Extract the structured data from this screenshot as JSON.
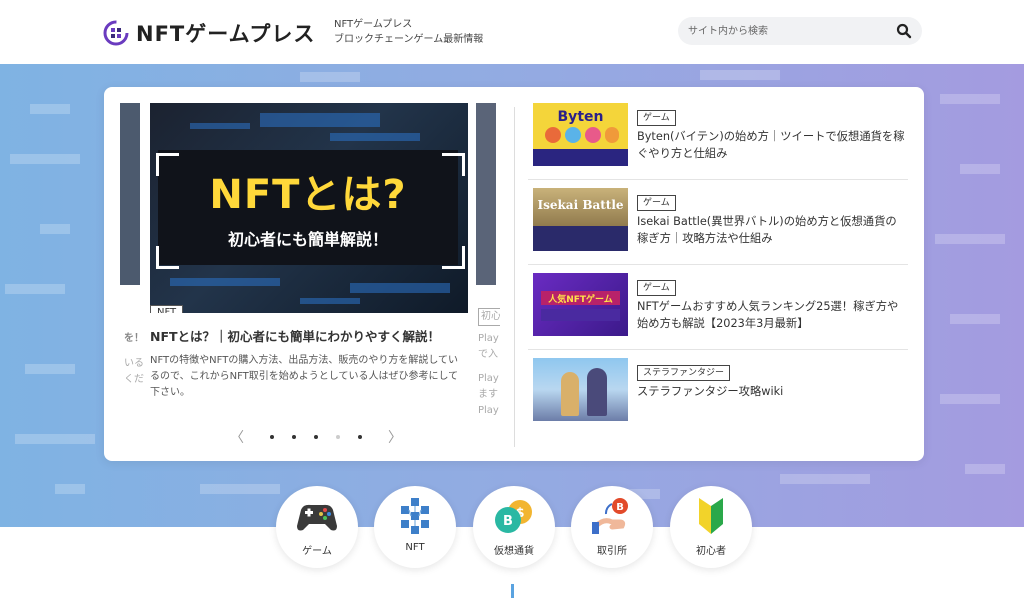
{
  "header": {
    "logo_text": "NFTゲームプレス",
    "tagline_1": "NFTゲームプレス",
    "tagline_2": "ブロックチェーンゲーム最新情報",
    "search_placeholder": "サイト内から検索"
  },
  "slider": {
    "prev_partial_title": "を！",
    "prev_partial_desc": [
      "いる",
      "くだ"
    ],
    "next_partial_tag": "初心",
    "next_partial_title": [
      "Play",
      "で入"
    ],
    "next_partial_desc": [
      "Play",
      "ます",
      "Play"
    ],
    "active_slide": {
      "image_title": "NFTとは?",
      "image_subtitle": "初心者にも簡単解説！",
      "tag": "NFT",
      "title": "NFTとは？｜初心者にも簡単にわかりやすく解説！",
      "desc": "NFTの特徴やNFTの購入方法、出品方法、販売のやり方を解説しているので、これからNFT取引を始めようとしている人はぜひ参考にして下さい。"
    },
    "prev_label": "〈",
    "next_label": "〉",
    "dots": [
      true,
      true,
      true,
      false,
      true
    ]
  },
  "posts": [
    {
      "tag": "ゲーム",
      "title": "Byten(バイテン)の始め方｜ツイートで仮想通貨を稼ぐやり方と仕組み",
      "thumb_title": "Byten"
    },
    {
      "tag": "ゲーム",
      "title": "Isekai Battle(異世界バトル)の始め方と仮想通貨の稼ぎ方｜攻略方法や仕組み",
      "thumb_title": "Isekai Battle"
    },
    {
      "tag": "ゲーム",
      "title": "NFTゲームおすすめ人気ランキング25選！稼ぎ方や始め方も解説【2023年3月最新】",
      "thumb_title": "人気NFTゲーム"
    },
    {
      "tag": "ステラファンタジー",
      "title": "ステラファンタジー攻略wiki",
      "thumb_title": ""
    }
  ],
  "categories": [
    {
      "label": "ゲーム",
      "icon": "gamepad-icon"
    },
    {
      "label": "NFT",
      "icon": "blocks-icon"
    },
    {
      "label": "仮想通貨",
      "icon": "coins-icon"
    },
    {
      "label": "取引所",
      "icon": "exchange-icon"
    },
    {
      "label": "初心者",
      "icon": "beginner-mark-icon"
    }
  ],
  "colors": {
    "hero_left": "#7fb3e3",
    "hero_right": "#a49be0",
    "accent_yellow": "#ffd83a",
    "logo_purple": "#6a3bbf"
  }
}
